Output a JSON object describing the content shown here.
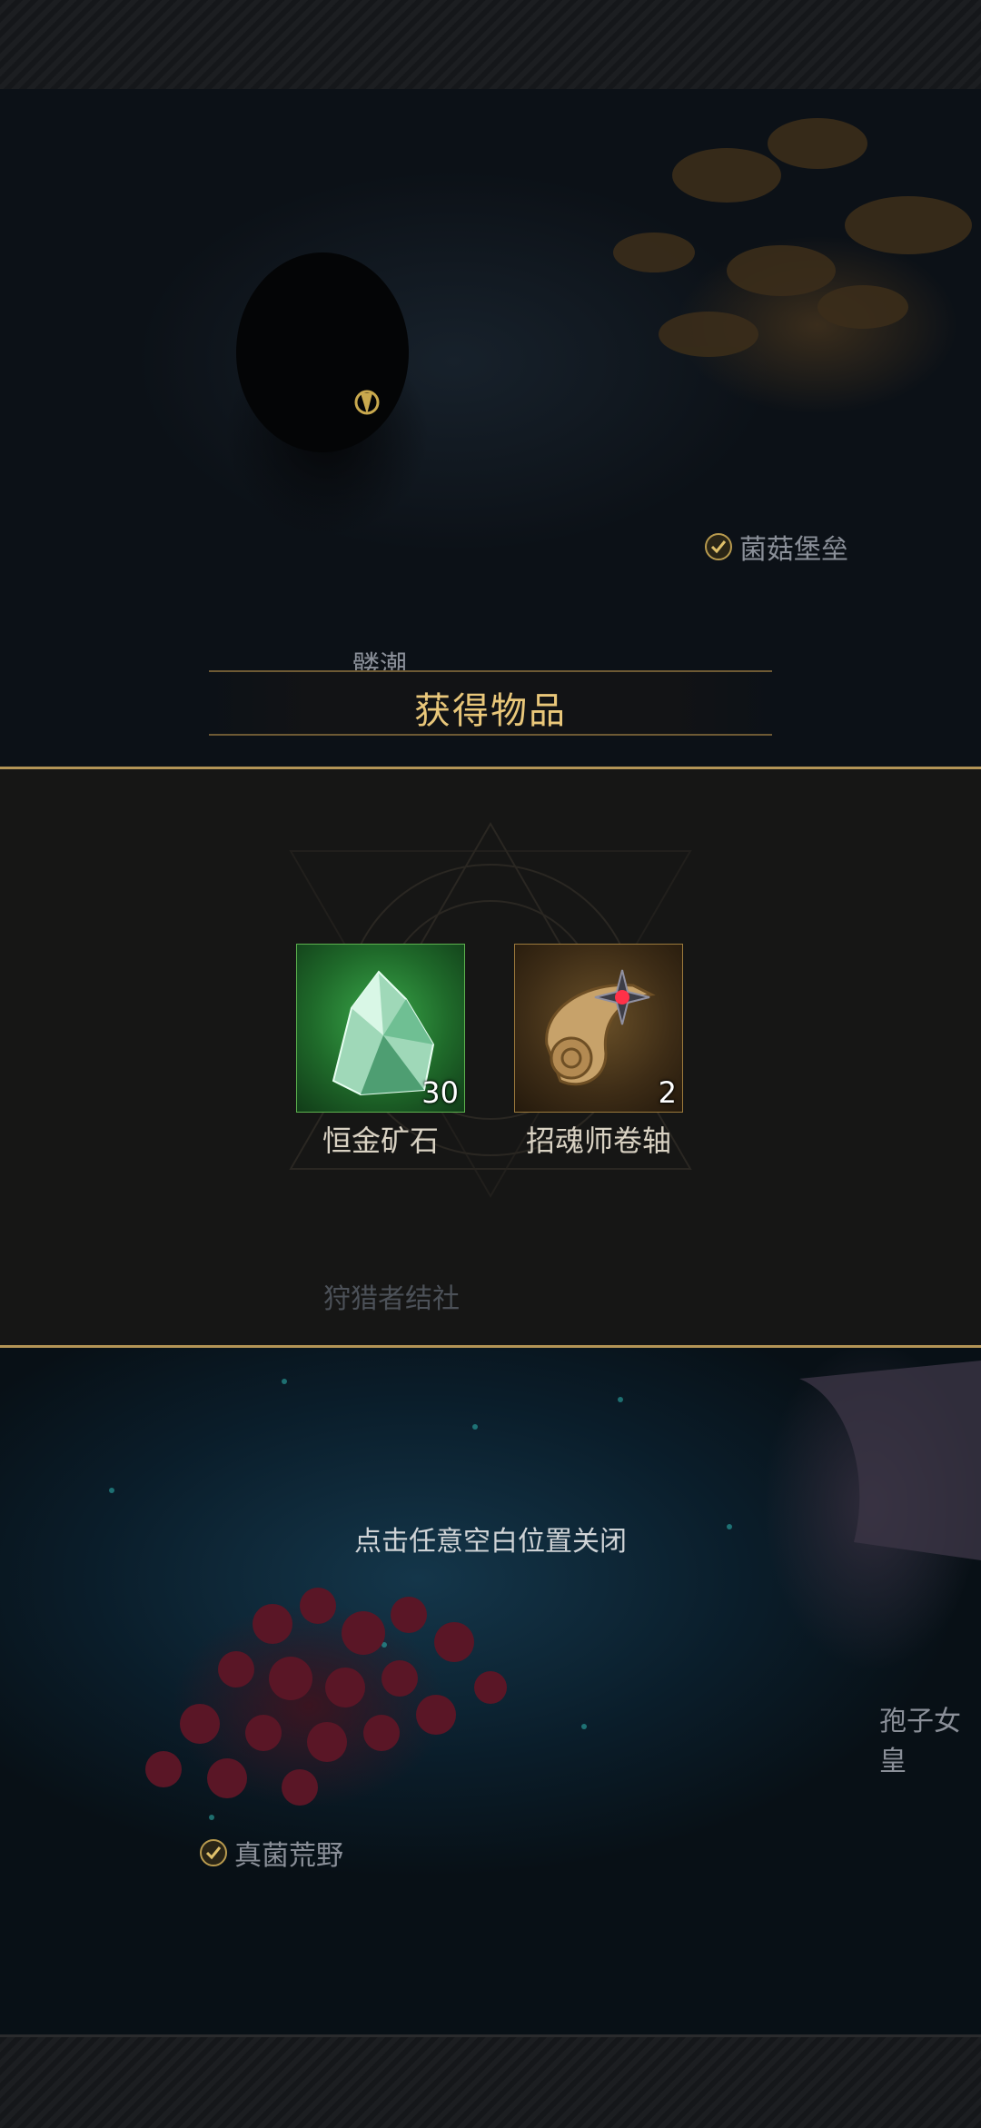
{
  "map_labels": {
    "mushroom_fortress": "菌菇堡垒",
    "skull_tide": "髅潮",
    "hunters_guild": "狩猎者结社",
    "spore_queen": "孢子女皇",
    "fungal_wilds": "真菌荒野"
  },
  "reward_popup": {
    "title": "获得物品",
    "items": [
      {
        "name": "恒金矿石",
        "count": "30",
        "rarity_color": "#3aa84a",
        "icon": "ore-crystal-icon"
      },
      {
        "name": "招魂师卷轴",
        "count": "2",
        "rarity_color": "#9c7a3c",
        "icon": "scroll-icon"
      }
    ],
    "close_hint": "点击任意空白位置关闭"
  },
  "colors": {
    "gold_accent": "#e9c77a",
    "panel_border": "#b39456"
  }
}
